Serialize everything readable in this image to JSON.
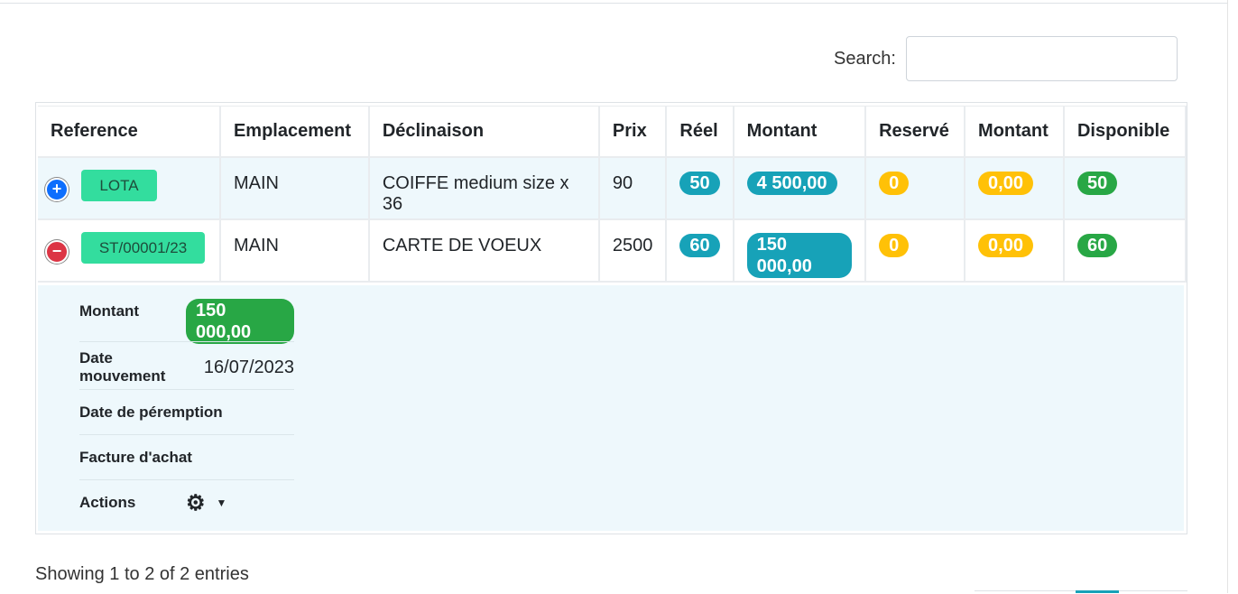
{
  "search": {
    "label": "Search:",
    "value": "",
    "placeholder": ""
  },
  "table": {
    "headers": [
      "Reference",
      "Emplacement",
      "Déclinaison",
      "Prix",
      "Réel",
      "Montant",
      "Reservé",
      "Montant",
      "Disponible"
    ],
    "rows": [
      {
        "ref": "LOTA",
        "emplacement": "MAIN",
        "declinaison": "COIFFE medium size x 36",
        "prix": "90",
        "reel": "50",
        "montant": "4 500,00",
        "reserve": "0",
        "montant_reserve": "0,00",
        "disponible": "50",
        "control": "+"
      },
      {
        "ref": "ST/00001/23",
        "emplacement": "MAIN",
        "declinaison": "CARTE DE VOEUX",
        "prix": "2500",
        "reel": "60",
        "montant": "150 000,00",
        "reserve": "0",
        "montant_reserve": "0,00",
        "disponible": "60",
        "control": "−"
      }
    ]
  },
  "detail": {
    "montant_label": "Montant",
    "montant_value": "150 000,00",
    "date_mouvement_label": "Date mouvement",
    "date_mouvement_value": "16/07/2023",
    "date_peremption_label": "Date de péremption",
    "facture_label": "Facture d'achat",
    "actions_label": "Actions"
  },
  "footer": {
    "info": "Showing 1 to 2 of 2 entries"
  },
  "icons": {
    "expand": "plus-circle-icon",
    "collapse": "minus-circle-icon",
    "actions": "gear-icon",
    "dropdown": "caret-down-icon"
  },
  "colors": {
    "ref_button": "#33dd9e",
    "info": "#17a2b8",
    "warning": "#ffc107",
    "success": "#28a745",
    "detail_bg": "#eef8fc"
  }
}
